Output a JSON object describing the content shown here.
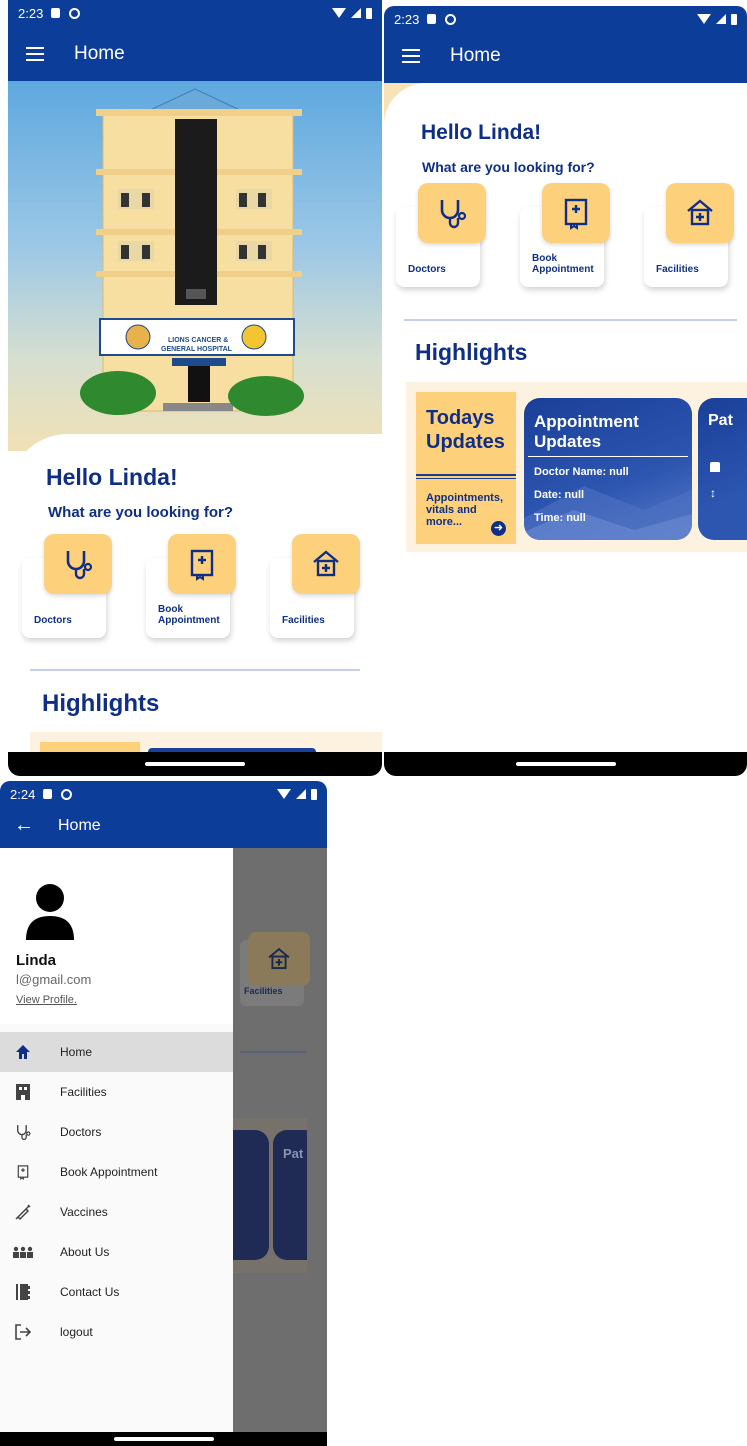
{
  "phone1": {
    "status_time": "2:23",
    "appbar_title": "Home",
    "hero": {
      "sign_line1": "LIONS CANCER &",
      "sign_line2": "GENERAL HOSPITAL"
    },
    "greeting": "Hello Linda!",
    "question": "What are you looking for?",
    "cards": [
      {
        "label": "Doctors",
        "icon": "stethoscope-icon"
      },
      {
        "label": "Book Appointment",
        "icon": "appointment-book-icon"
      },
      {
        "label": "Facilities",
        "icon": "hospital-icon"
      }
    ],
    "highlights_title": "Highlights"
  },
  "phone2": {
    "status_time": "2:23",
    "appbar_title": "Home",
    "greeting": "Hello Linda!",
    "question": "What are you looking for?",
    "cards": [
      {
        "label": "Doctors",
        "icon": "stethoscope-icon"
      },
      {
        "label": "Book Appointment",
        "icon": "appointment-book-icon"
      },
      {
        "label": "Facilities",
        "icon": "hospital-icon"
      }
    ],
    "highlights_title": "Highlights",
    "todays_updates": {
      "title_line1": "Todays",
      "title_line2": "Updates",
      "desc_line1": "Appointments,",
      "desc_line2": "vitals and",
      "desc_line3": "more..."
    },
    "appointment_updates": {
      "title_line1": "Appointment",
      "title_line2": "Updates",
      "doctor_name": "Doctor Name: null",
      "date": "Date: null",
      "time": "Time: null"
    },
    "next_card_title": "Pat"
  },
  "phone3": {
    "status_time": "2:24",
    "appbar_title": "Home",
    "user": {
      "name": "Linda",
      "email": "l@gmail.com",
      "view_profile": "View Profile."
    },
    "background_card_label": "Facilities",
    "background_next_card_title": "Pat",
    "menu": [
      {
        "label": "Home",
        "icon": "home-icon",
        "selected": true
      },
      {
        "label": "Facilities",
        "icon": "building-icon",
        "selected": false
      },
      {
        "label": "Doctors",
        "icon": "stethoscope-icon",
        "selected": false
      },
      {
        "label": "Book Appointment",
        "icon": "appointment-book-icon",
        "selected": false
      },
      {
        "label": "Vaccines",
        "icon": "syringe-icon",
        "selected": false
      },
      {
        "label": "About Us",
        "icon": "people-icon",
        "selected": false
      },
      {
        "label": "Contact Us",
        "icon": "contact-book-icon",
        "selected": false
      },
      {
        "label": "logout",
        "icon": "logout-icon",
        "selected": false
      }
    ]
  },
  "colors": {
    "primary": "#0c3d98",
    "accent": "#fdd07b",
    "text_dark_blue": "#0f2f86"
  }
}
